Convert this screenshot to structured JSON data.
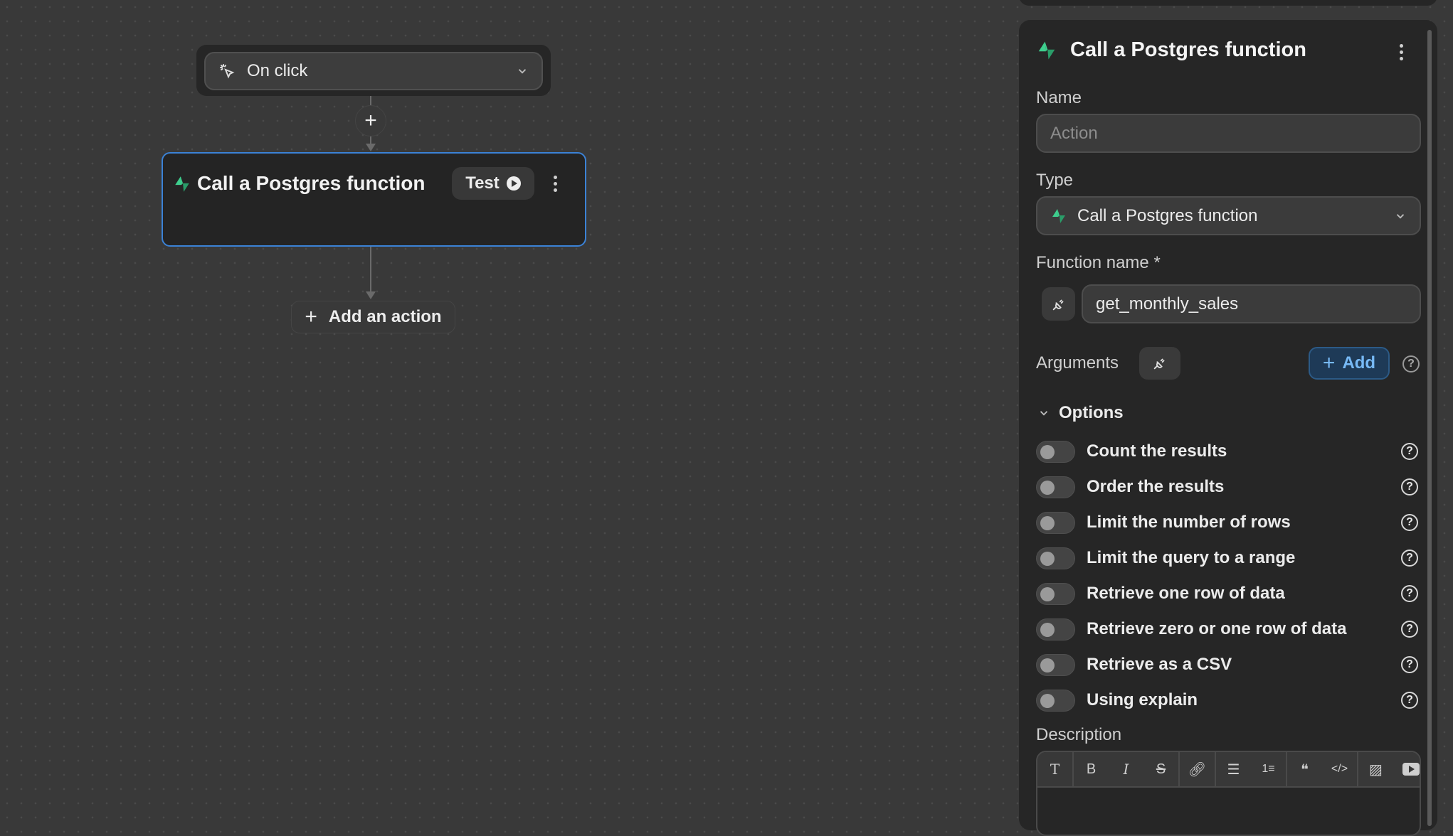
{
  "canvas": {
    "trigger": {
      "label": "On click",
      "icon": "cursor-click-icon"
    },
    "add_step": "+",
    "action_card": {
      "title": "Call a Postgres function",
      "test_label": "Test"
    },
    "add_action": {
      "plus": "+",
      "label": "Add an action"
    }
  },
  "panel": {
    "title": "Call a Postgres function",
    "name": {
      "label": "Name",
      "placeholder": "Action",
      "value": ""
    },
    "type": {
      "label": "Type",
      "value": "Call a Postgres function"
    },
    "function_name": {
      "label": "Function name",
      "required": "*",
      "value": "get_monthly_sales"
    },
    "arguments": {
      "label": "Arguments",
      "add_plus": "+",
      "add_label": "Add",
      "help": "?"
    },
    "options": {
      "label": "Options",
      "items": [
        {
          "label": "Count the results",
          "enabled": false
        },
        {
          "label": "Order the results",
          "enabled": false
        },
        {
          "label": "Limit the number of rows",
          "enabled": false
        },
        {
          "label": "Limit the query to a range",
          "enabled": false
        },
        {
          "label": "Retrieve one row of data",
          "enabled": false
        },
        {
          "label": "Retrieve zero or one row of data",
          "enabled": false
        },
        {
          "label": "Retrieve as a CSV",
          "enabled": false
        },
        {
          "label": "Using explain",
          "enabled": false
        }
      ],
      "help": "?"
    },
    "description": {
      "label": "Description",
      "toolbar": {
        "text": "T",
        "bold": "B",
        "italic": "I",
        "strike": "S"
      }
    }
  },
  "colors": {
    "accent": "#3b82d6",
    "brand_green": "#3ecf8e",
    "add_text": "#77b9f5"
  }
}
